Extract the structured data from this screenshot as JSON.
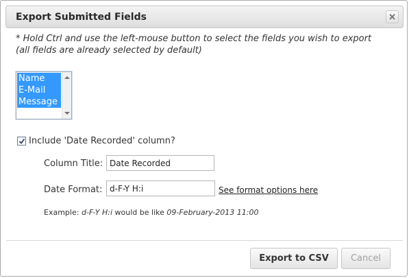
{
  "dialog": {
    "title": "Export Submitted Fields",
    "close_icon": "close-x-icon"
  },
  "hint": {
    "line1": "* Hold Ctrl and use the left-mouse button to select the fields you wish to export",
    "line2": "(all fields are already selected by default)"
  },
  "fields_list": {
    "options": [
      "Name",
      "E-Mail",
      "Message"
    ],
    "selected": [
      "Name",
      "E-Mail",
      "Message"
    ]
  },
  "include_date": {
    "checked": true,
    "label": "Include 'Date Recorded' column?"
  },
  "column_title": {
    "label": "Column Title:",
    "value": "Date Recorded"
  },
  "date_format": {
    "label": "Date Format:",
    "value": "d-F-Y H:i",
    "link_text": "See format options here"
  },
  "example": {
    "prefix": "Example: ",
    "format": "d-F-Y H:i",
    "middle": " would be like ",
    "result": "09-February-2013 11:00"
  },
  "buttons": {
    "export_label": "Export to CSV",
    "cancel_label": "Cancel"
  },
  "colors": {
    "selection": "#3399ff",
    "disabled_text": "#a0a0a0"
  }
}
